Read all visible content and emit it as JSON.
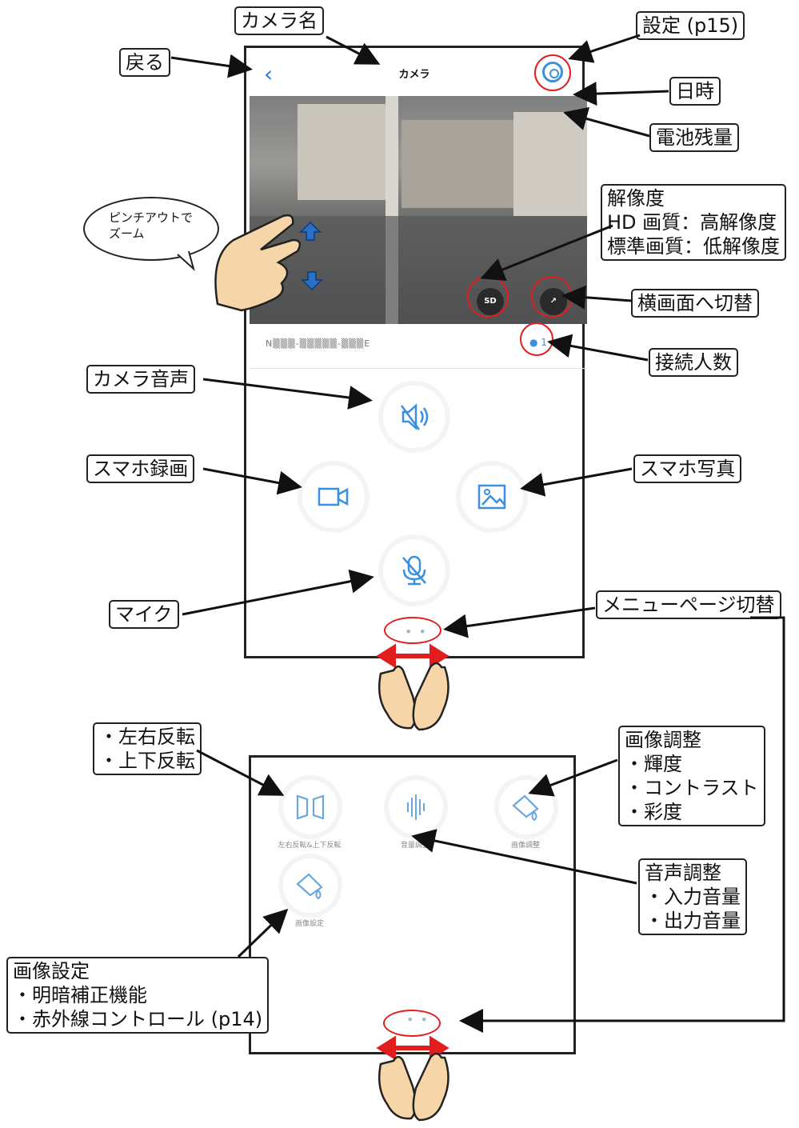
{
  "app_screen": {
    "title": "カメラ",
    "device_name": "N▒▒▒-▒▒▒▒▒-▒▒▒E",
    "viewer_count": "1",
    "resolution_badge": "SD"
  },
  "page2": {
    "btn1_label": "左右反転&上下反転",
    "btn2_label": "音量調整",
    "btn3_label": "画像調整",
    "btn4_label": "画像設定"
  },
  "bubble": {
    "line1": "ピンチアウトで",
    "line2": "ズーム"
  },
  "callouts": {
    "camera_name": "カメラ名",
    "settings": "設定 (p15)",
    "back": "戻る",
    "datetime": "日時",
    "battery": "電池残量",
    "resolution": [
      "解像度",
      "HD 画質：高解像度",
      "標準画質：低解像度"
    ],
    "landscape": "横画面へ切替",
    "viewers": "接続人数",
    "camera_audio": "カメラ音声",
    "phone_record": "スマホ録画",
    "phone_photo": "スマホ写真",
    "mic": "マイク",
    "menu_page": "メニューページ切替",
    "flip": [
      "・左右反転",
      "・上下反転"
    ],
    "image_adjust": [
      "画像調整",
      "・輝度",
      "・コントラスト",
      "・彩度"
    ],
    "audio_adjust": [
      "音声調整",
      "・入力音量",
      "・出力音量"
    ],
    "image_settings": [
      "画像設定",
      "・明暗補正機能",
      "・赤外線コントロール (p14)"
    ]
  },
  "colors": {
    "accent": "#3a8fe0",
    "highlight_red": "#e21d1d"
  }
}
